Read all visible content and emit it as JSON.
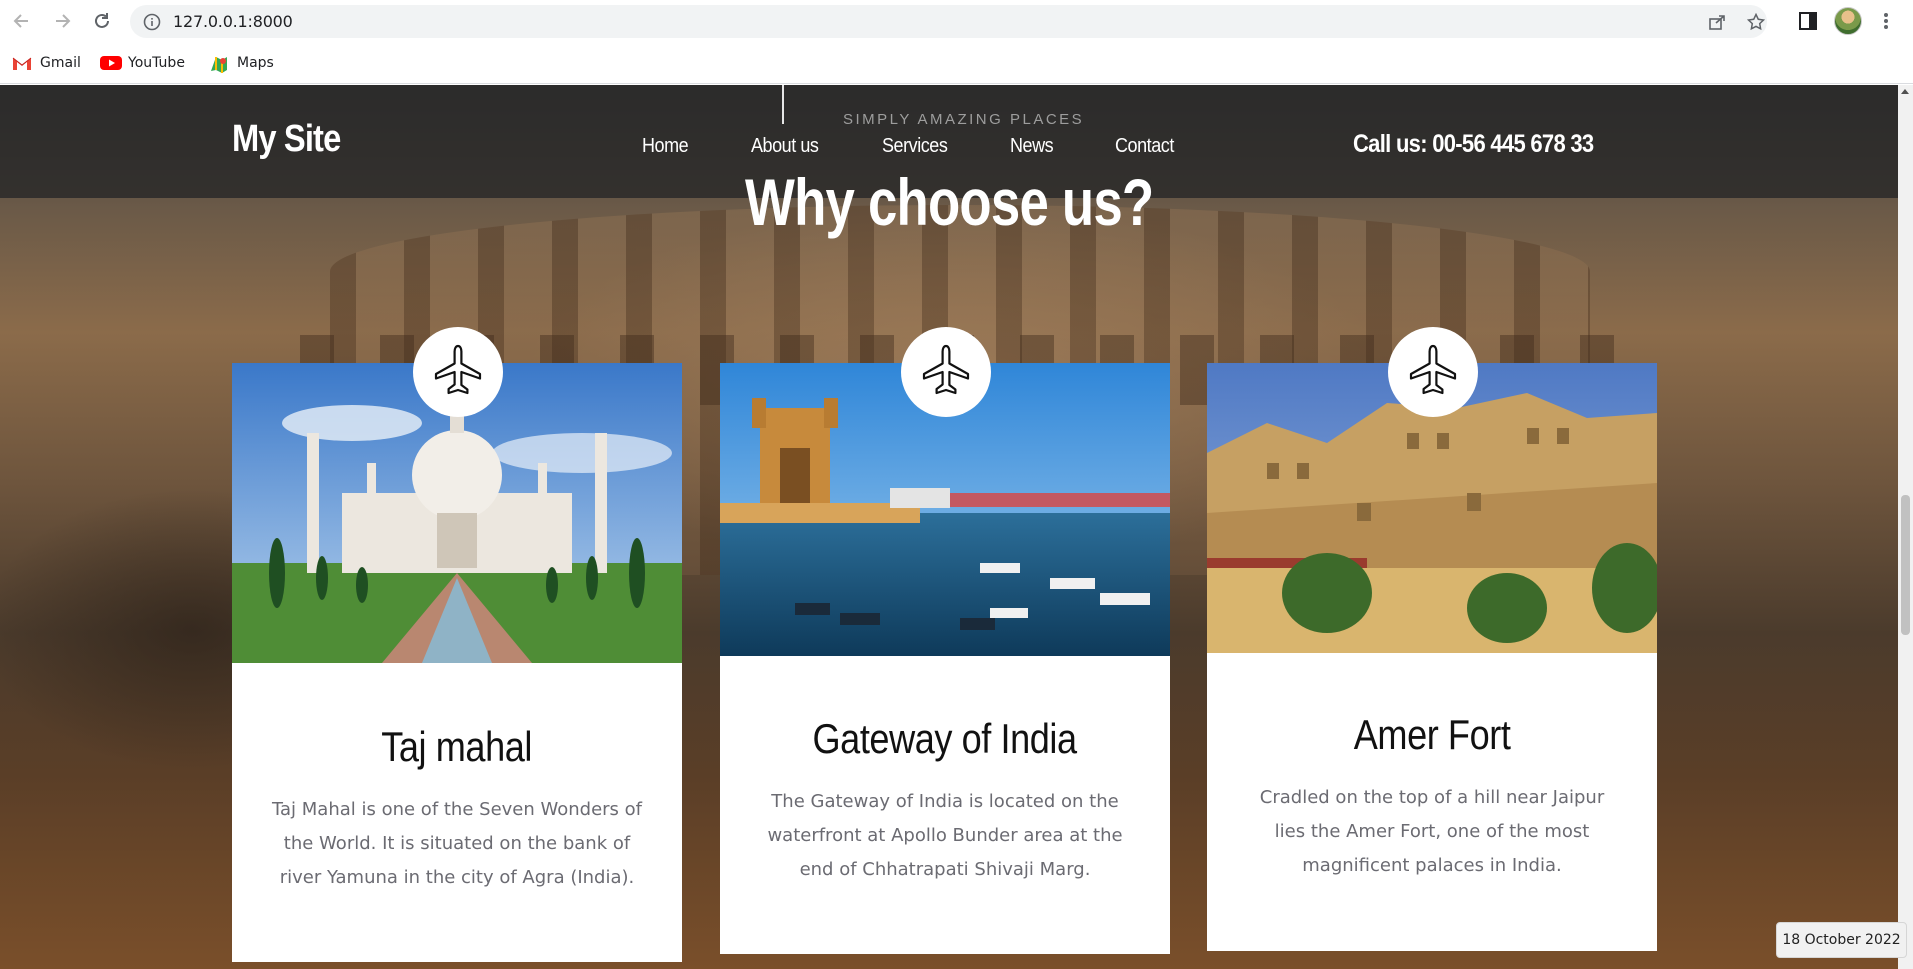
{
  "browser": {
    "url": "127.0.0.1:8000",
    "bookmarks": [
      {
        "label": "Gmail",
        "icon": "gmail-icon"
      },
      {
        "label": "YouTube",
        "icon": "youtube-icon"
      },
      {
        "label": "Maps",
        "icon": "maps-icon"
      }
    ]
  },
  "site": {
    "logo": "My Site",
    "tagline": "SIMPLY AMAZING PLACES",
    "nav": [
      "Home",
      "About us",
      "Services",
      "News",
      "Contact"
    ],
    "phone": "Call us: 00-56 445 678 33"
  },
  "section": {
    "title": "Why choose us?"
  },
  "cards": [
    {
      "title": "Taj mahal",
      "description": "Taj Mahal is one of the Seven Wonders of the World. It is situated on the bank of river Yamuna in the city of Agra (India).",
      "icon": "airplane-icon"
    },
    {
      "title": "Gateway of India",
      "description": "The Gateway of India is located on the waterfront at Apollo Bunder area at the end of Chhatrapati Shivaji Marg.",
      "icon": "airplane-icon"
    },
    {
      "title": "Amer Fort",
      "description": "Cradled on the top of a hill near Jaipur lies the Amer Fort, one of the most magnificent palaces in India.",
      "icon": "airplane-icon"
    }
  ],
  "taskbar": {
    "date": "18 October 2022"
  }
}
